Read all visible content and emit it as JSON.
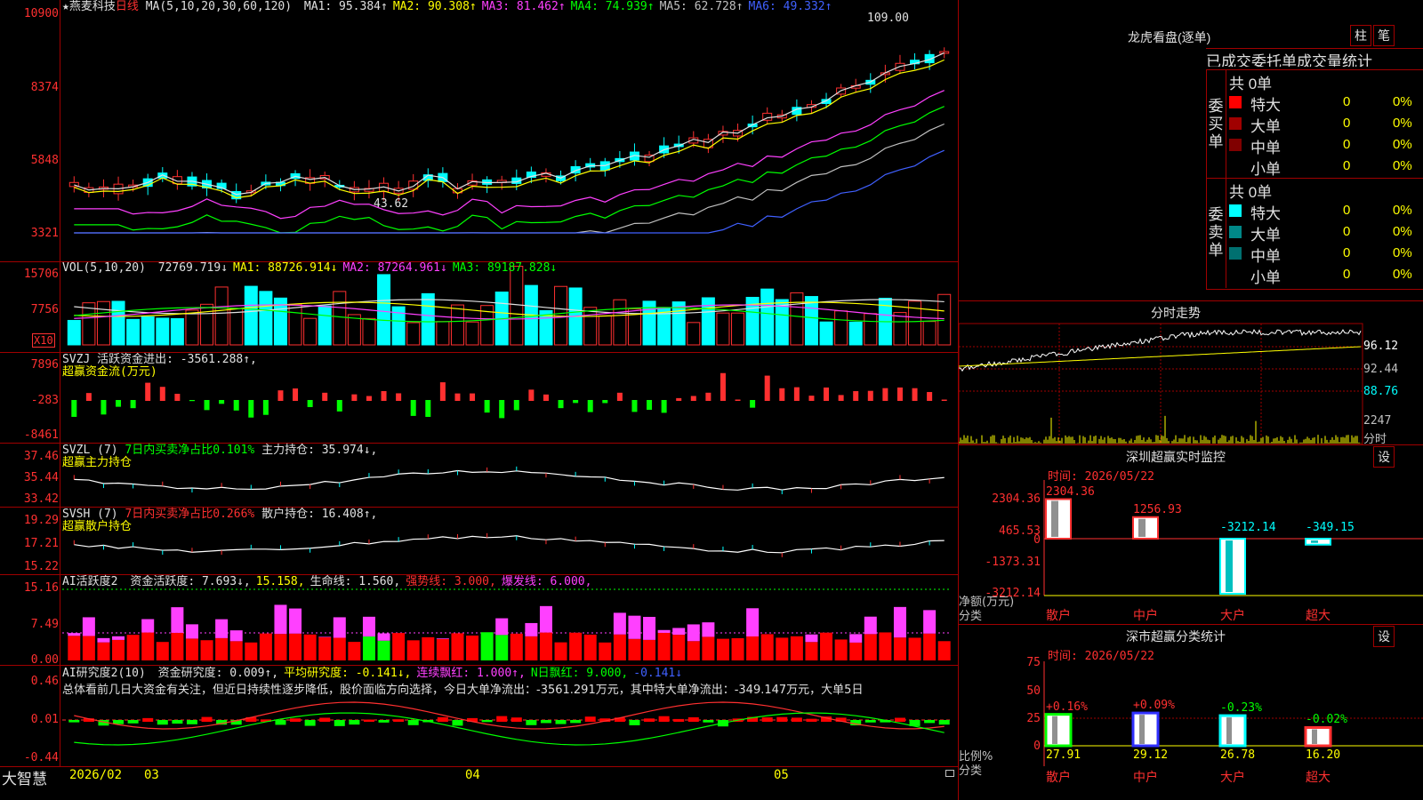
{
  "stock": {
    "star": "★",
    "name": "燕麦科技",
    "period": "日线"
  },
  "ma_header": {
    "label": "MA(5,10,20,30,60,120)",
    "items": [
      {
        "text": "MA1: 95.384↑",
        "color": "#e0e0e0"
      },
      {
        "text": "MA2: 90.308↑",
        "color": "#ffff00"
      },
      {
        "text": "MA3: 81.462↑",
        "color": "#ff40ff"
      },
      {
        "text": "MA4: 74.939↑",
        "color": "#00ff00"
      },
      {
        "text": "MA5: 62.728↑",
        "color": "#c0c0c0"
      },
      {
        "text": "MA6: 49.332↑",
        "color": "#4060ff"
      }
    ]
  },
  "price_axis": [
    "10900",
    "8374",
    "5848",
    "3321"
  ],
  "price_high_label": "109.00",
  "price_low_label": "43.62",
  "vol_header": {
    "label": "VOL(5,10,20)",
    "items": [
      {
        "text": "72769.719↓",
        "color": "#e0e0e0"
      },
      {
        "text": "MA1: 88726.914↓",
        "color": "#ffff00"
      },
      {
        "text": "MA2: 87264.961↓",
        "color": "#ff40ff"
      },
      {
        "text": "MA3: 89187.828↓",
        "color": "#00ff00"
      }
    ]
  },
  "vol_axis": [
    "15706",
    "7756"
  ],
  "vol_unit": "X10",
  "svzj": {
    "label": "SVZJ",
    "text": "活跃资金进出: -3561.288↑,",
    "sub": "超赢资金流(万元)"
  },
  "svzj_axis": [
    "7896",
    "-283",
    "-8461"
  ],
  "svzl": {
    "label": "SVZL (7)",
    "t1": "7日内买卖净占比0.101%",
    "t2": "主力持仓: 35.974↓,",
    "sub": "超赢主力持仓"
  },
  "svzl_axis": [
    "37.46",
    "35.44",
    "33.42"
  ],
  "svsh": {
    "label": "SVSH (7)",
    "t1": "7日内买卖净占比0.266%",
    "t2": "散户持仓: 16.408↑,",
    "sub": "超赢散户持仓"
  },
  "svsh_axis": [
    "19.29",
    "17.21",
    "15.22"
  ],
  "ai1": {
    "label": "AI活跃度2",
    "items": [
      {
        "text": "资金活跃度: 7.693↓,",
        "color": "#e0e0e0"
      },
      {
        "text": "15.158,",
        "color": "#ffff00"
      },
      {
        "text": "生命线: 1.560,",
        "color": "#e0e0e0"
      },
      {
        "text": "强势线: 3.000,",
        "color": "#ff3030"
      },
      {
        "text": "爆发线: 6.000,",
        "color": "#ff40ff"
      }
    ]
  },
  "ai1_axis": [
    "15.16",
    "7.49",
    "0.00"
  ],
  "ai2": {
    "label": "AI研究度2(10)",
    "items": [
      {
        "text": "资金研究度: 0.009↑,",
        "color": "#e0e0e0"
      },
      {
        "text": "平均研究度: -0.141↓,",
        "color": "#ffff00"
      },
      {
        "text": "连续飘红: 1.000↑,",
        "color": "#ff40ff"
      },
      {
        "text": "N日飘红: 9.000,",
        "color": "#00ff00"
      },
      {
        "text": "-0.141↓",
        "color": "#4060ff"
      }
    ],
    "summary": "总体看前几日大资金有关注，但近日持续性逐步降低，股价面临方向选择，今日大单净流出：-3561.291万元，其中特大单净流出：-349.147万元，大单5日"
  },
  "ai2_axis": [
    "0.46",
    "0.01",
    "-0.44"
  ],
  "bottom_bar": {
    "brand": "大智慧",
    "dates": [
      "2026/02",
      "03",
      "04",
      "05"
    ]
  },
  "dragon": {
    "title": "龙虎看盘(逐单)",
    "btn_zhu": "柱",
    "btn_bi": "笔",
    "headline": "已成交委托单成交量统计",
    "buy_label": "委买单",
    "sell_label": "委卖单",
    "buy_total": "共 0单",
    "sell_total": "共 0单",
    "buy_rows": [
      {
        "name": "特大",
        "count": "0",
        "pct": "0%",
        "color": "#ff0000"
      },
      {
        "name": "大单",
        "count": "0",
        "pct": "0%",
        "color": "#a00000"
      },
      {
        "name": "中单",
        "count": "0",
        "pct": "0%",
        "color": "#800000"
      },
      {
        "name": "小单",
        "count": "0",
        "pct": "0%",
        "color": ""
      }
    ],
    "sell_rows": [
      {
        "name": "特大",
        "count": "0",
        "pct": "0%",
        "color": "#00ffff"
      },
      {
        "name": "大单",
        "count": "0",
        "pct": "0%",
        "color": "#008888"
      },
      {
        "name": "中单",
        "count": "0",
        "pct": "0%",
        "color": "#007070"
      },
      {
        "name": "小单",
        "count": "0",
        "pct": "0%",
        "color": ""
      }
    ]
  },
  "intraday": {
    "title": "分时走势",
    "axis": [
      "96.12",
      "92.44",
      "88.76"
    ],
    "vol_label": "2247",
    "unit_label": "分时"
  },
  "sz_monitor": {
    "title": "深圳超赢实时监控",
    "settings": "设",
    "time": "时间: 2026/05/22",
    "axis": [
      "2304.36",
      "465.53",
      "0",
      "-1373.31",
      "-3212.14"
    ],
    "unit_label": "净额(万元)",
    "category_label": "分类",
    "bars": [
      {
        "name": "散户",
        "value": "2304.36"
      },
      {
        "name": "中户",
        "value": "1256.93"
      },
      {
        "name": "大户",
        "value": "-3212.14"
      },
      {
        "name": "超大",
        "value": "-349.15"
      }
    ]
  },
  "sz_class": {
    "title": "深市超赢分类统计",
    "settings": "设",
    "time": "时间: 2026/05/22",
    "axis": [
      "75",
      "50",
      "25",
      "0"
    ],
    "ratio_label": "比例%",
    "category_label": "分类",
    "bars": [
      {
        "name": "散户",
        "pct": "+0.16%",
        "value": "27.91"
      },
      {
        "name": "中户",
        "pct": "+0.09%",
        "value": "29.12"
      },
      {
        "name": "大户",
        "pct": "-0.23%",
        "value": "26.78"
      },
      {
        "name": "超大",
        "pct": "-0.02%",
        "value": "16.20"
      }
    ]
  }
}
